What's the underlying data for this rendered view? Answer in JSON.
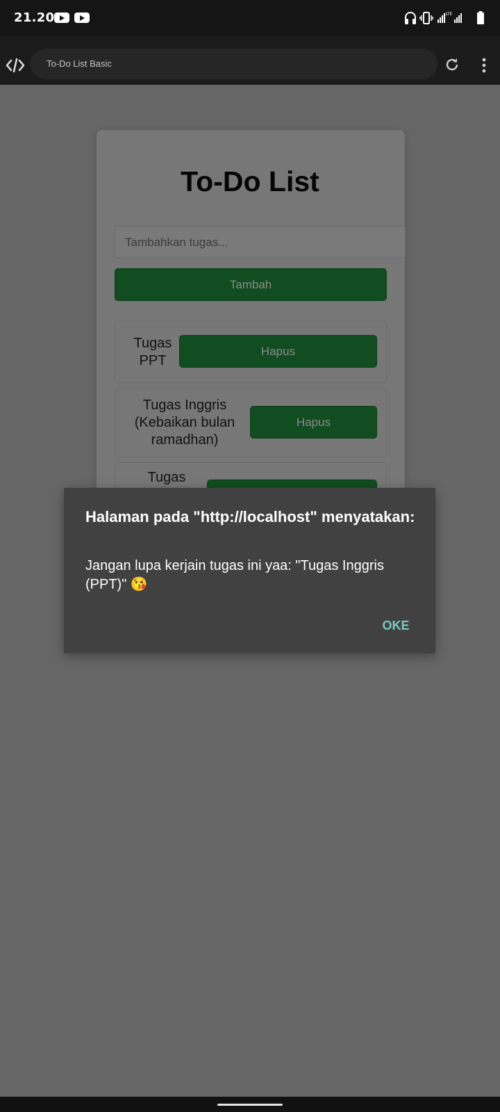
{
  "status_bar": {
    "time": "21.20",
    "icons": [
      "youtube-icon",
      "youtube-icon",
      "headphones-icon",
      "vibrate-icon",
      "signal-lte-icon",
      "signal-icon",
      "battery-icon"
    ],
    "network_label": "LTE"
  },
  "browser": {
    "page_title": "To-Do List Basic",
    "icons": [
      "code-icon",
      "reload-icon",
      "more-vert-icon"
    ]
  },
  "app": {
    "title": "To-Do List",
    "input_placeholder": "Tambahkan tugas...",
    "add_button": "Tambah",
    "tasks": [
      {
        "text": "Tugas PPT",
        "delete_label": "Hapus"
      },
      {
        "text": "Tugas Inggris (Kebaikan bulan ramadhan)",
        "delete_label": "Hapus"
      },
      {
        "text": "Tugas",
        "delete_label": ""
      }
    ]
  },
  "dialog": {
    "title": "Halaman pada \"http://localhost\" menyatakan:",
    "message": "Jangan lupa kerjain tugas ini yaa: \"Tugas Inggris (PPT)\" 😘",
    "ok_label": "OKE"
  },
  "colors": {
    "accent_green": "#114d20",
    "dialog_bg": "#414141",
    "ok_text": "#79c9c0",
    "overlay": "#666666"
  }
}
